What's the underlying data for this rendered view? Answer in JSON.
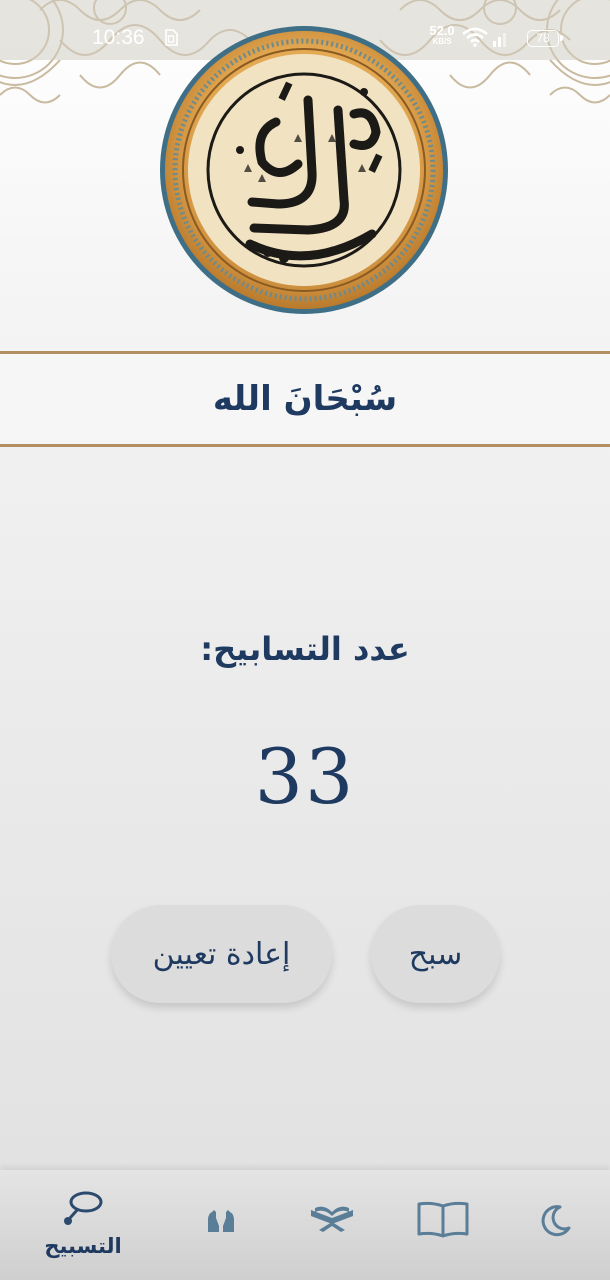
{
  "status_bar": {
    "time": "10:36",
    "net_speed": "52.0",
    "net_speed_unit": "KB/S",
    "battery": "78"
  },
  "dhikr": {
    "text": "سُبْحَانَ الله"
  },
  "counter": {
    "label": "عدد التسابيح:",
    "value": "33"
  },
  "buttons": {
    "praise": "سبح",
    "reset": "إعادة تعيين"
  },
  "bottom_nav": {
    "items": [
      {
        "icon": "prayer-beads-icon",
        "label": "التسبيح",
        "active": true
      },
      {
        "icon": "praying-hands-icon"
      },
      {
        "icon": "quran-stand-icon"
      },
      {
        "icon": "open-book-icon"
      },
      {
        "icon": "crescent-moon-icon"
      }
    ]
  },
  "colors": {
    "primary_text": "#1f3a60",
    "accent_gold": "#b28f63",
    "button_bg": "#dcdcdc"
  }
}
